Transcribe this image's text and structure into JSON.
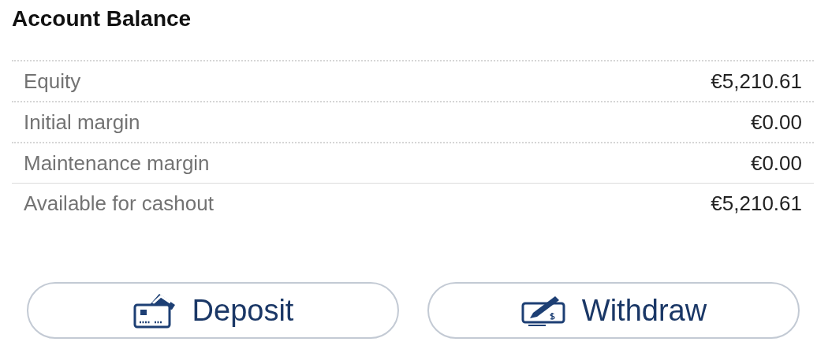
{
  "title": "Account Balance",
  "rows": [
    {
      "label": "Equity",
      "value": "€5,210.61"
    },
    {
      "label": "Initial margin",
      "value": "€0.00"
    },
    {
      "label": "Maintenance margin",
      "value": "€0.00"
    },
    {
      "label": "Available for cashout",
      "value": "€5,210.61"
    }
  ],
  "buttons": [
    {
      "label": "Deposit",
      "kind": "card"
    },
    {
      "label": "Withdraw",
      "kind": "cheque"
    }
  ]
}
